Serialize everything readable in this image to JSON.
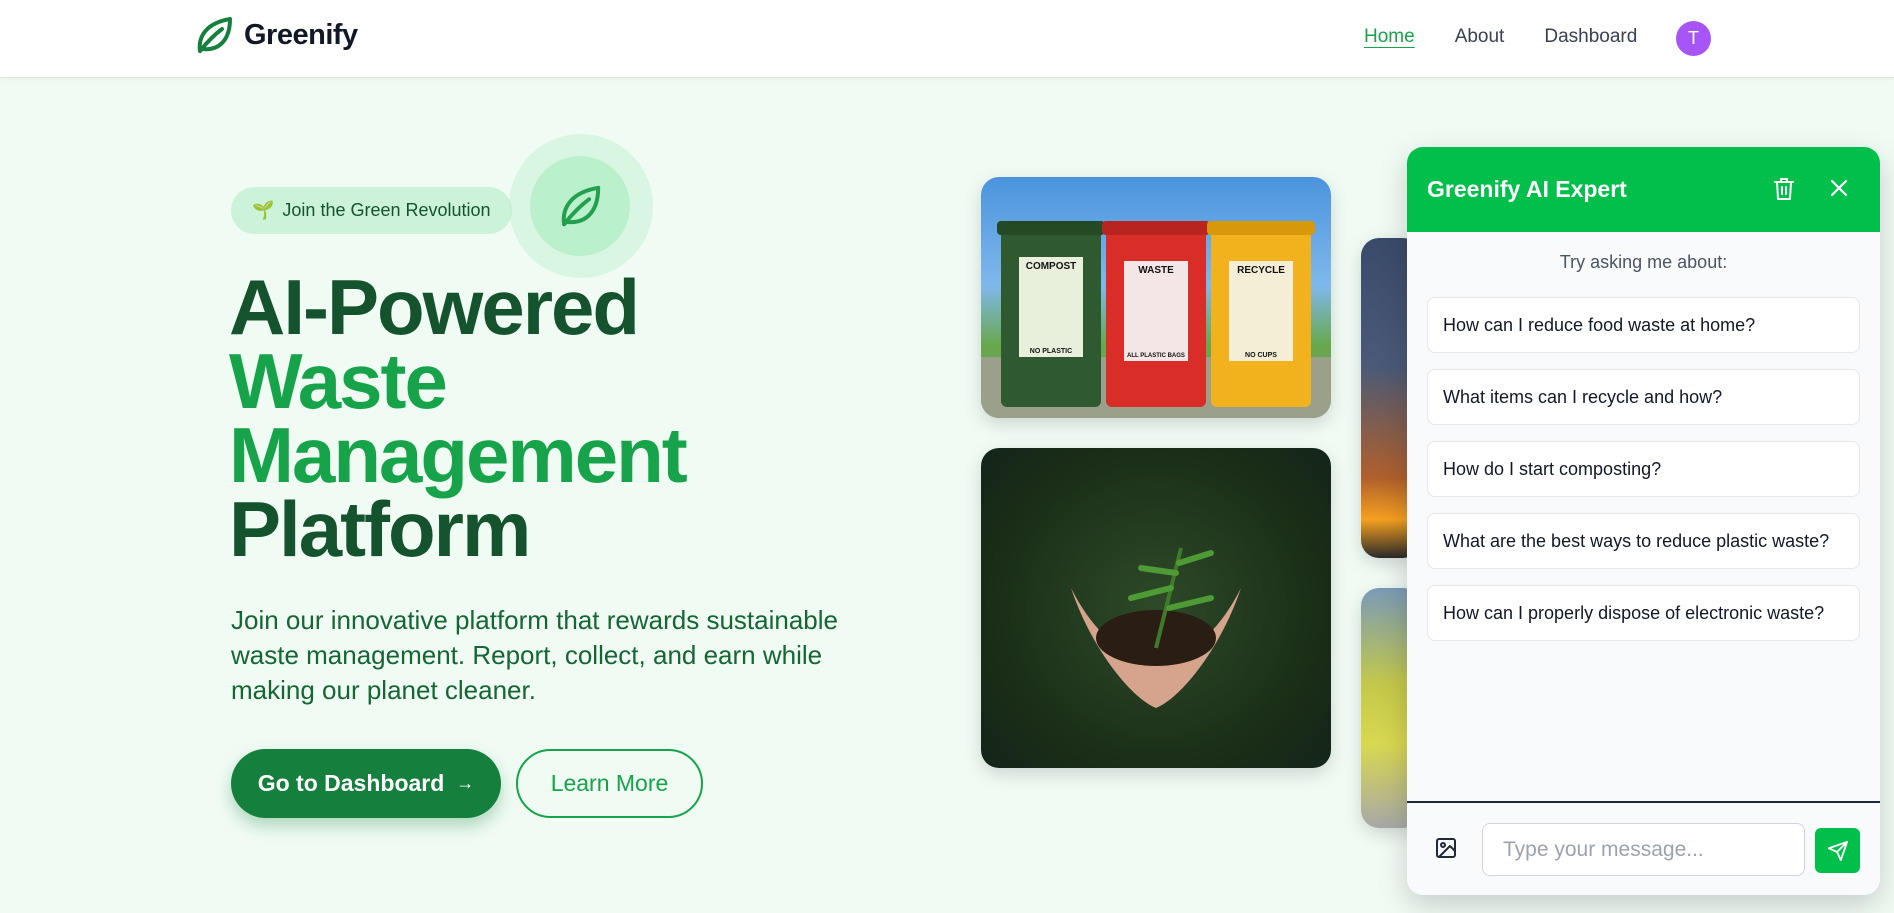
{
  "nav": {
    "brand": "Greenify",
    "links": [
      "Home",
      "About",
      "Dashboard"
    ],
    "active": "Home",
    "avatar_initial": "T"
  },
  "hero": {
    "badge_icon": "🌱",
    "badge": "Join the Green Revolution",
    "title_line1": "AI-Powered",
    "title_line2": "Waste",
    "title_line3": "Management",
    "title_line4": "Platform",
    "description": "Join our innovative platform that rewards sustainable waste management. Report, collect, and earn while making our planet cleaner.",
    "primary_button": "Go to Dashboard",
    "primary_arrow": "→",
    "secondary_button": "Learn More"
  },
  "images": {
    "bins_labels": [
      "COMPOST",
      "WASTE",
      "RECYCLE"
    ],
    "bins_sublabels": [
      "NO PLASTIC",
      "ALL PLASTIC BAGS",
      "NO CUPS"
    ]
  },
  "chat": {
    "title": "Greenify AI Expert",
    "hint": "Try asking me about:",
    "suggestions": [
      "How can I reduce food waste at home?",
      "What items can I recycle and how?",
      "How do I start composting?",
      "What are the best ways to reduce plastic waste?",
      "How can I properly dispose of electronic waste?"
    ],
    "input_placeholder": "Type your message..."
  },
  "colors": {
    "brand_green": "#16a34a",
    "dark_green": "#14532d",
    "chat_header": "#00c04b",
    "avatar": "#a855f7",
    "page_bg": "#f0fbf4"
  }
}
